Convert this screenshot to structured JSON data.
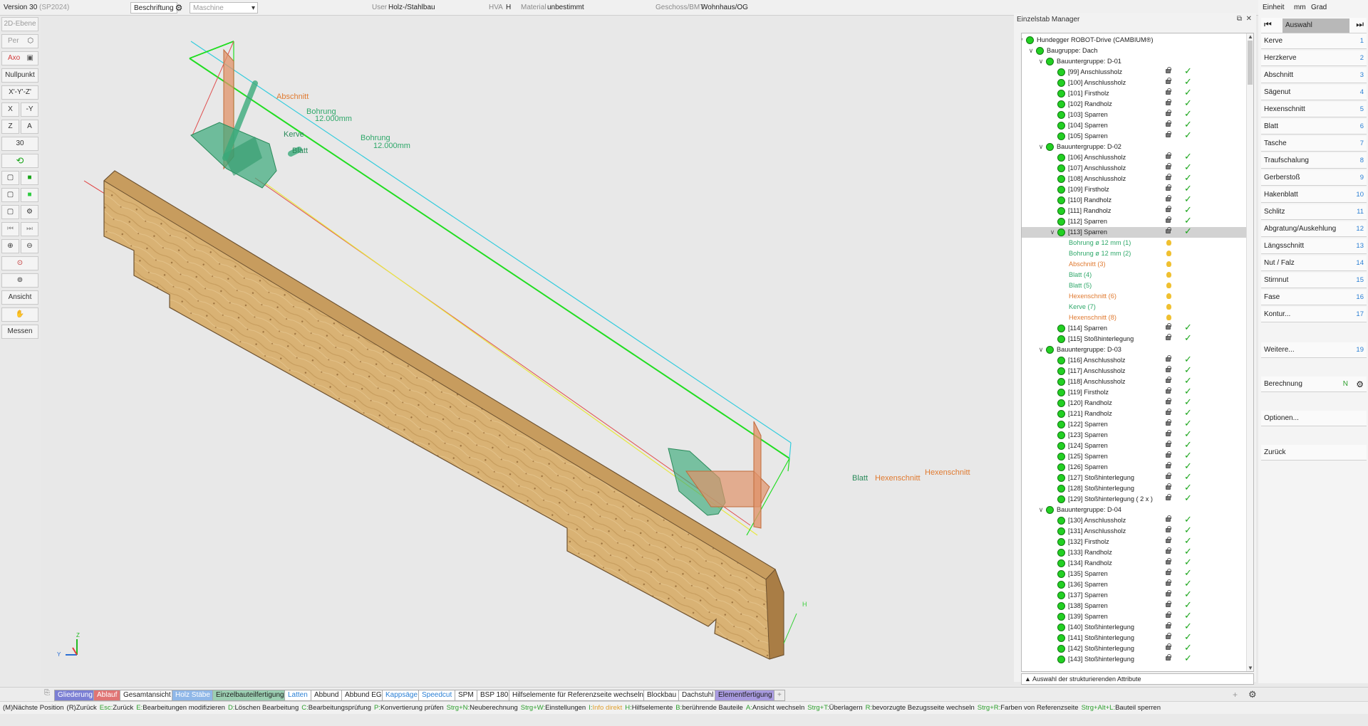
{
  "topbar": {
    "version": "Version 30",
    "version_suffix": "(SP2024)",
    "beschriftung": "Beschriftung",
    "maschine_placeholder": "Maschine",
    "user_label": "User",
    "user_value": "Holz-/Stahlbau",
    "hva_label": "HVA",
    "hva_value": "H",
    "material_label": "Material",
    "material_value": "unbestimmt",
    "geschoss_label": "Geschoss/BMT",
    "geschoss_value": "Wohnhaus/OG"
  },
  "left_toolbar": {
    "ebene": "2D-Ebene",
    "per": "Per",
    "axo": "Axo",
    "nullpunkt": "Nullpunkt",
    "axes": "X'-Y'-Z'",
    "x": "X",
    "my": "-Y",
    "z": "Z",
    "a": "A",
    "thirty": "30",
    "ansicht": "Ansicht",
    "messen": "Messen"
  },
  "viewport": {
    "labels": {
      "abschnitt": "Abschnitt",
      "bohrung1": "Bohrung",
      "bohrung1_val": "12.000mm",
      "bohrung2": "Bohrung",
      "bohrung2_val": "12.000mm",
      "kerve": "Kerve",
      "blatt": "Blatt",
      "blatt2": "Blatt",
      "hexenschnitt1": "Hexenschnitt",
      "hexenschnitt2": "Hexenschnitt"
    },
    "axis": {
      "z": "Z",
      "y": "Y",
      "h": "H"
    }
  },
  "manager": {
    "title": "Einzelstab Manager",
    "footer": "Auswahl der strukturierenden Attribute",
    "tree": [
      {
        "lvl": 0,
        "exp": "∨",
        "dot": true,
        "label": "Hundegger ROBOT-Drive (CAMBIUM®)"
      },
      {
        "lvl": 1,
        "exp": "∨",
        "dot": true,
        "label": "Baugruppe: Dach"
      },
      {
        "lvl": 2,
        "exp": "∨",
        "dot": true,
        "label": "Bauuntergruppe: D-01"
      },
      {
        "lvl": 3,
        "dot": true,
        "label": "[99] Anschlussholz",
        "lock": true,
        "check": true
      },
      {
        "lvl": 3,
        "dot": true,
        "label": "[100] Anschlussholz",
        "lock": true,
        "check": true
      },
      {
        "lvl": 3,
        "dot": true,
        "label": "[101] Firstholz",
        "lock": true,
        "check": true
      },
      {
        "lvl": 3,
        "dot": true,
        "label": "[102] Randholz",
        "lock": true,
        "check": true
      },
      {
        "lvl": 3,
        "dot": true,
        "label": "[103] Sparren",
        "lock": true,
        "check": true
      },
      {
        "lvl": 3,
        "dot": true,
        "label": "[104] Sparren",
        "lock": true,
        "check": true
      },
      {
        "lvl": 3,
        "dot": true,
        "label": "[105] Sparren",
        "lock": true,
        "check": true
      },
      {
        "lvl": 2,
        "exp": "∨",
        "dot": true,
        "label": "Bauuntergruppe: D-02"
      },
      {
        "lvl": 3,
        "dot": true,
        "label": "[106] Anschlussholz",
        "lock": true,
        "check": true
      },
      {
        "lvl": 3,
        "dot": true,
        "label": "[107] Anschlussholz",
        "lock": true,
        "check": true
      },
      {
        "lvl": 3,
        "dot": true,
        "label": "[108] Anschlussholz",
        "lock": true,
        "check": true
      },
      {
        "lvl": 3,
        "dot": true,
        "label": "[109] Firstholz",
        "lock": true,
        "check": true
      },
      {
        "lvl": 3,
        "dot": true,
        "label": "[110] Randholz",
        "lock": true,
        "check": true
      },
      {
        "lvl": 3,
        "dot": true,
        "label": "[111] Randholz",
        "lock": true,
        "check": true
      },
      {
        "lvl": 3,
        "dot": true,
        "label": "[112] Sparren",
        "lock": true,
        "check": true
      },
      {
        "lvl": 3,
        "exp": "∨",
        "dot": true,
        "label": "[113] Sparren",
        "lock": true,
        "check": true,
        "selected": true
      },
      {
        "lvl": 4,
        "label": "Bohrung ø 12 mm (1)",
        "color": "#2fa86a",
        "bulb": true
      },
      {
        "lvl": 4,
        "label": "Bohrung ø 12 mm (2)",
        "color": "#2fa86a",
        "bulb": true
      },
      {
        "lvl": 4,
        "label": "Abschnitt (3)",
        "color": "#e07a30",
        "bulb": true
      },
      {
        "lvl": 4,
        "label": "Blatt (4)",
        "color": "#2fa86a",
        "bulb": true
      },
      {
        "lvl": 4,
        "label": "Blatt (5)",
        "color": "#2fa86a",
        "bulb": true
      },
      {
        "lvl": 4,
        "label": "Hexenschnitt (6)",
        "color": "#e07a30",
        "bulb": true
      },
      {
        "lvl": 4,
        "label": "Kerve (7)",
        "color": "#2fa86a",
        "bulb": true
      },
      {
        "lvl": 4,
        "label": "Hexenschnitt (8)",
        "color": "#e07a30",
        "bulb": true
      },
      {
        "lvl": 3,
        "dot": true,
        "label": "[114] Sparren",
        "lock": true,
        "check": true
      },
      {
        "lvl": 3,
        "dot": true,
        "label": "[115] Stoßhinterlegung",
        "lock": true,
        "check": true
      },
      {
        "lvl": 2,
        "exp": "∨",
        "dot": true,
        "label": "Bauuntergruppe: D-03"
      },
      {
        "lvl": 3,
        "dot": true,
        "label": "[116] Anschlussholz",
        "lock": true,
        "check": true
      },
      {
        "lvl": 3,
        "dot": true,
        "label": "[117] Anschlussholz",
        "lock": true,
        "check": true
      },
      {
        "lvl": 3,
        "dot": true,
        "label": "[118] Anschlussholz",
        "lock": true,
        "check": true
      },
      {
        "lvl": 3,
        "dot": true,
        "label": "[119] Firstholz",
        "lock": true,
        "check": true
      },
      {
        "lvl": 3,
        "dot": true,
        "label": "[120] Randholz",
        "lock": true,
        "check": true
      },
      {
        "lvl": 3,
        "dot": true,
        "label": "[121] Randholz",
        "lock": true,
        "check": true
      },
      {
        "lvl": 3,
        "dot": true,
        "label": "[122] Sparren",
        "lock": true,
        "check": true
      },
      {
        "lvl": 3,
        "dot": true,
        "label": "[123] Sparren",
        "lock": true,
        "check": true
      },
      {
        "lvl": 3,
        "dot": true,
        "label": "[124] Sparren",
        "lock": true,
        "check": true
      },
      {
        "lvl": 3,
        "dot": true,
        "label": "[125] Sparren",
        "lock": true,
        "check": true
      },
      {
        "lvl": 3,
        "dot": true,
        "label": "[126] Sparren",
        "lock": true,
        "check": true
      },
      {
        "lvl": 3,
        "dot": true,
        "label": "[127] Stoßhinterlegung",
        "lock": true,
        "check": true
      },
      {
        "lvl": 3,
        "dot": true,
        "label": "[128] Stoßhinterlegung",
        "lock": true,
        "check": true
      },
      {
        "lvl": 3,
        "dot": true,
        "label": "[129] Stoßhinterlegung ( 2 x )",
        "lock": true,
        "check": true
      },
      {
        "lvl": 2,
        "exp": "∨",
        "dot": true,
        "label": "Bauuntergruppe: D-04"
      },
      {
        "lvl": 3,
        "dot": true,
        "label": "[130] Anschlussholz",
        "lock": true,
        "check": true
      },
      {
        "lvl": 3,
        "dot": true,
        "label": "[131] Anschlussholz",
        "lock": true,
        "check": true
      },
      {
        "lvl": 3,
        "dot": true,
        "label": "[132] Firstholz",
        "lock": true,
        "check": true
      },
      {
        "lvl": 3,
        "dot": true,
        "label": "[133] Randholz",
        "lock": true,
        "check": true
      },
      {
        "lvl": 3,
        "dot": true,
        "label": "[134] Randholz",
        "lock": true,
        "check": true
      },
      {
        "lvl": 3,
        "dot": true,
        "label": "[135] Sparren",
        "lock": true,
        "check": true
      },
      {
        "lvl": 3,
        "dot": true,
        "label": "[136] Sparren",
        "lock": true,
        "check": true
      },
      {
        "lvl": 3,
        "dot": true,
        "label": "[137] Sparren",
        "lock": true,
        "check": true
      },
      {
        "lvl": 3,
        "dot": true,
        "label": "[138] Sparren",
        "lock": true,
        "check": true
      },
      {
        "lvl": 3,
        "dot": true,
        "label": "[139] Sparren",
        "lock": true,
        "check": true
      },
      {
        "lvl": 3,
        "dot": true,
        "label": "[140] Stoßhinterlegung",
        "lock": true,
        "check": true
      },
      {
        "lvl": 3,
        "dot": true,
        "label": "[141] Stoßhinterlegung",
        "lock": true,
        "check": true
      },
      {
        "lvl": 3,
        "dot": true,
        "label": "[142] Stoßhinterlegung",
        "lock": true,
        "check": true
      },
      {
        "lvl": 3,
        "dot": true,
        "label": "[143] Stoßhinterlegung",
        "lock": true,
        "check": true
      }
    ]
  },
  "right_menu": {
    "einheit": "Einheit",
    "mm": "mm",
    "grad": "Grad",
    "auswahl": "Auswahl",
    "items": [
      {
        "label": "Kerve",
        "num": "1"
      },
      {
        "label": "Herzkerve",
        "num": "2"
      },
      {
        "label": "Abschnitt",
        "num": "3"
      },
      {
        "label": "Sägenut",
        "num": "4"
      },
      {
        "label": "Hexenschnitt",
        "num": "5"
      },
      {
        "label": "Blatt",
        "num": "6"
      },
      {
        "label": "Tasche",
        "num": "7"
      },
      {
        "label": "Traufschalung",
        "num": "8"
      },
      {
        "label": "Gerberstoß",
        "num": "9"
      },
      {
        "label": "Hakenblatt",
        "num": "10"
      },
      {
        "label": "Schlitz",
        "num": "11"
      },
      {
        "label": "Abgratung/Auskehlung",
        "num": "12"
      },
      {
        "label": "Längsschnitt",
        "num": "13"
      },
      {
        "label": "Nut / Falz",
        "num": "14"
      },
      {
        "label": "Stirnnut",
        "num": "15"
      },
      {
        "label": "Fase",
        "num": "16"
      },
      {
        "label": "Kontur...",
        "num": "17"
      }
    ],
    "weitere": "Weitere...",
    "weitere_num": "19",
    "berechnung": "Berechnung",
    "berechnung_flag": "N",
    "optionen": "Optionen...",
    "zurueck": "Zurück"
  },
  "tabs": [
    {
      "label": "Gliederung",
      "bg": "#7b7fd4",
      "fg": "#fff"
    },
    {
      "label": "Ablauf",
      "bg": "#e07474",
      "fg": "#fff"
    },
    {
      "label": "Gesamtansicht",
      "bg": "#ffffff",
      "fg": "#222"
    },
    {
      "label": "Holz Stäbe",
      "bg": "#8fb7e8",
      "fg": "#fff"
    },
    {
      "label": "Einzelbauteilfertigung",
      "bg": "#9ccfb2",
      "fg": "#222"
    },
    {
      "label": "Latten",
      "bg": "#ffffff",
      "fg": "#2a7fd4"
    },
    {
      "label": "Abbund",
      "bg": "#ffffff",
      "fg": "#222"
    },
    {
      "label": "Abbund EG",
      "bg": "#ffffff",
      "fg": "#222"
    },
    {
      "label": "Kappsäge",
      "bg": "#ffffff",
      "fg": "#2a7fd4"
    },
    {
      "label": "Speedcut",
      "bg": "#ffffff",
      "fg": "#2a7fd4"
    },
    {
      "label": "SPM",
      "bg": "#ffffff",
      "fg": "#222"
    },
    {
      "label": "BSP 180",
      "bg": "#ffffff",
      "fg": "#222"
    },
    {
      "label": "Hilfselemente für Referenzseite wechseln",
      "bg": "#ffffff",
      "fg": "#222"
    },
    {
      "label": "Blockbau",
      "bg": "#ffffff",
      "fg": "#222"
    },
    {
      "label": "Dachstuhl",
      "bg": "#ffffff",
      "fg": "#222"
    },
    {
      "label": "Elementfertigung",
      "bg": "#a99be0",
      "fg": "#222"
    },
    {
      "label": "+",
      "bg": "#ececec",
      "fg": "#888"
    }
  ],
  "status": [
    {
      "text": "(M)Nächste Position",
      "color": "#222"
    },
    {
      "text": "(R)Zurück",
      "color": "#222"
    },
    {
      "text": "Esc:",
      "color": "#2ea02e"
    },
    {
      "text": "Zurück",
      "color": "#222"
    },
    {
      "text": "E:",
      "color": "#2ea02e"
    },
    {
      "text": "Bearbeitungen modifizieren",
      "color": "#222"
    },
    {
      "text": "D:",
      "color": "#2ea02e"
    },
    {
      "text": "Löschen Bearbeitung",
      "color": "#222"
    },
    {
      "text": "C:",
      "color": "#2ea02e"
    },
    {
      "text": "Bearbeitungsprüfung",
      "color": "#222"
    },
    {
      "text": "P:",
      "color": "#2ea02e"
    },
    {
      "text": "Konvertierung prüfen",
      "color": "#222"
    },
    {
      "text": "Strg+N:",
      "color": "#2ea02e"
    },
    {
      "text": "Neuberechnung",
      "color": "#222"
    },
    {
      "text": "Strg+W:",
      "color": "#2ea02e"
    },
    {
      "text": "Einstellungen",
      "color": "#222"
    },
    {
      "text": "I:",
      "color": "#2ea02e"
    },
    {
      "text": "Info direkt",
      "color": "#e0a030"
    },
    {
      "text": "H:",
      "color": "#2ea02e"
    },
    {
      "text": "Hilfselemente",
      "color": "#222"
    },
    {
      "text": "B:",
      "color": "#2ea02e"
    },
    {
      "text": "berührende Bauteile",
      "color": "#222"
    },
    {
      "text": "A:",
      "color": "#2ea02e"
    },
    {
      "text": "Ansicht wechseln",
      "color": "#222"
    },
    {
      "text": "Strg+T:",
      "color": "#2ea02e"
    },
    {
      "text": "Überlagern",
      "color": "#222"
    },
    {
      "text": "R:",
      "color": "#2ea02e"
    },
    {
      "text": "bevorzugte Bezugsseite wechseln",
      "color": "#222"
    },
    {
      "text": "Strg+R:",
      "color": "#2ea02e"
    },
    {
      "text": "Farben von Referenzseite",
      "color": "#222"
    },
    {
      "text": "Strg+Alt+L:",
      "color": "#2ea02e"
    },
    {
      "text": "Bauteil sperren",
      "color": "#222"
    }
  ]
}
